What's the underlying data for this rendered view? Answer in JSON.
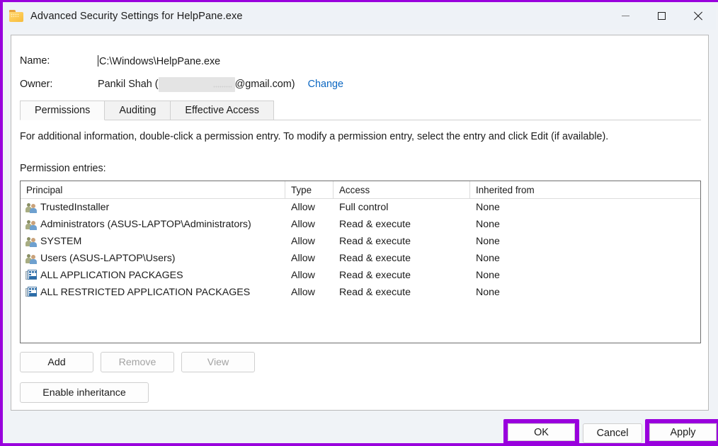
{
  "window": {
    "title": "Advanced Security Settings for HelpPane.exe",
    "icon": "folder-icon",
    "minimize_label": "Minimize",
    "maximize_label": "Maximize",
    "close_label": "Close",
    "annotation_color": "#9900dd"
  },
  "fields": {
    "name_label": "Name:",
    "name_value": "C:\\Windows\\HelpPane.exe",
    "owner_label": "Owner:",
    "owner_value_prefix": "Pankil Shah (",
    "owner_value_suffix": "@gmail.com)",
    "owner_redacted": true,
    "owner_change_link": "Change",
    "link_color": "#0b67c2"
  },
  "tabs": [
    {
      "label": "Permissions",
      "active": true
    },
    {
      "label": "Auditing",
      "active": false
    },
    {
      "label": "Effective Access",
      "active": false
    }
  ],
  "instruction": "For additional information, double-click a permission entry. To modify a permission entry, select the entry and click Edit (if available).",
  "entries_label": "Permission entries:",
  "table": {
    "columns": [
      "Principal",
      "Type",
      "Access",
      "Inherited from"
    ],
    "rows": [
      {
        "icon": "users-group-icon",
        "principal": "TrustedInstaller",
        "type": "Allow",
        "access": "Full control",
        "inherited": "None"
      },
      {
        "icon": "users-group-icon",
        "principal": "Administrators (ASUS-LAPTOP\\Administrators)",
        "type": "Allow",
        "access": "Read & execute",
        "inherited": "None"
      },
      {
        "icon": "users-group-icon",
        "principal": "SYSTEM",
        "type": "Allow",
        "access": "Read & execute",
        "inherited": "None"
      },
      {
        "icon": "users-group-icon",
        "principal": "Users (ASUS-LAPTOP\\Users)",
        "type": "Allow",
        "access": "Read & execute",
        "inherited": "None"
      },
      {
        "icon": "app-package-icon",
        "principal": "ALL APPLICATION PACKAGES",
        "type": "Allow",
        "access": "Read & execute",
        "inherited": "None"
      },
      {
        "icon": "app-package-icon",
        "principal": "ALL RESTRICTED APPLICATION PACKAGES",
        "type": "Allow",
        "access": "Read & execute",
        "inherited": "None"
      }
    ]
  },
  "actions": {
    "add": "Add",
    "remove": "Remove",
    "remove_disabled": true,
    "view": "View",
    "view_disabled": true,
    "inheritance": "Enable inheritance"
  },
  "footer": {
    "ok": "OK",
    "cancel": "Cancel",
    "apply": "Apply",
    "ok_highlighted": true,
    "apply_highlighted": true
  }
}
